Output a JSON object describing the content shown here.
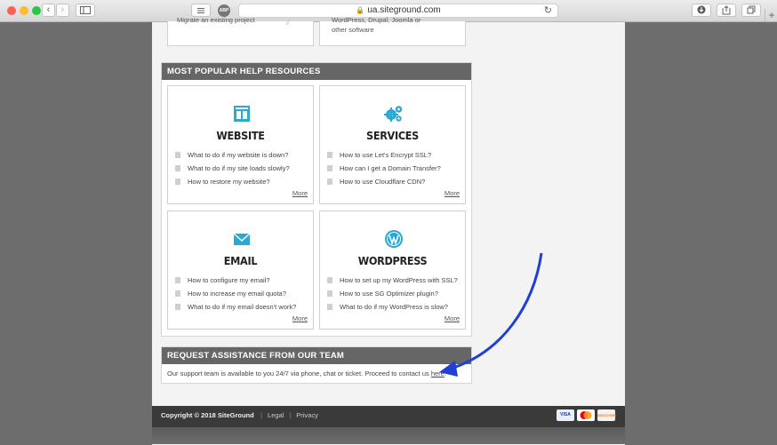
{
  "browser": {
    "url": "ua.siteground.com",
    "abp_label": "ABP"
  },
  "top_cards": {
    "left_text": "Migrate an existing project",
    "right_text_line1": "WordPress, Drupal, Joomla or",
    "right_text_line2": "other software"
  },
  "popular": {
    "heading": "MOST POPULAR HELP RESOURCES",
    "cards": [
      {
        "title": "WEBSITE",
        "icon": "website-layout-icon",
        "links": [
          "What to do if my website is down?",
          "What to do if my site loads slowly?",
          "How to restore my website?"
        ],
        "more": "More"
      },
      {
        "title": "SERVICES",
        "icon": "gears-icon",
        "links": [
          "How to use Let's Encrypt SSL?",
          "How can I get a Domain Transfer?",
          "How to use Cloudflare CDN?"
        ],
        "more": "More"
      },
      {
        "title": "EMAIL",
        "icon": "envelope-icon",
        "links": [
          "How to configure my email?",
          "How to increase my email quota?",
          "What to do if my email doesn't work?"
        ],
        "more": "More"
      },
      {
        "title": "WORDPRESS",
        "icon": "wordpress-icon",
        "links": [
          "How to set up my WordPress with SSL?",
          "How to use SG Optimizer plugin?",
          "What to do if my WordPress is slow?"
        ],
        "more": "More"
      }
    ]
  },
  "assistance": {
    "heading": "REQUEST ASSISTANCE FROM OUR TEAM",
    "text": "Our support team is available to you 24/7 via phone, chat or ticket. Proceed to contact us ",
    "link": "here",
    "tail": "."
  },
  "footer": {
    "copyright": "Copyright © 2018 SiteGround",
    "legal": "Legal",
    "privacy": "Privacy",
    "payment": [
      "VISA",
      "MC",
      "DISCOVER"
    ]
  },
  "colors": {
    "accent": "#29a9d4",
    "annotation_arrow": "#1f3fd6",
    "section_header": "#666666"
  }
}
